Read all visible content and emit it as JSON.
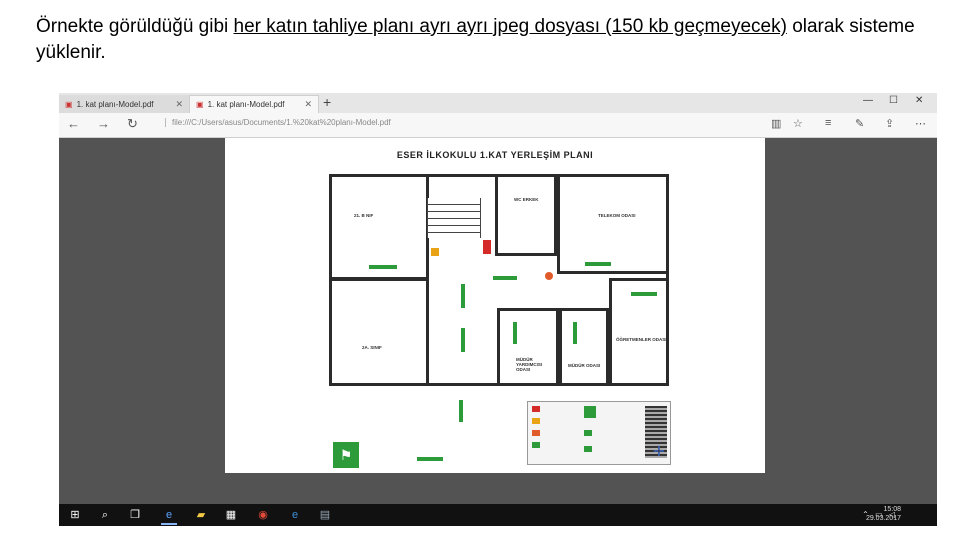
{
  "caption": {
    "part1": "Örnekte görüldüğü gibi ",
    "underlined": "her katın tahliye planı ayrı ayrı jpeg dosyası (150 kb geçmeyecek)",
    "part2": " olarak sisteme yüklenir."
  },
  "browser": {
    "tabs": [
      {
        "label": "1. kat planı-Model.pdf",
        "active": false
      },
      {
        "label": "1. kat planı-Model.pdf",
        "active": true
      }
    ],
    "new_tab": "+",
    "window_controls": {
      "minimize": "—",
      "maximize": "☐",
      "close": "✕"
    },
    "address": "file:///C:/Users/asus/Documents/1.%20kat%20planı-Model.pdf",
    "icons": [
      "back-icon",
      "forward-icon",
      "refresh-icon",
      "reading-view-icon",
      "favorite-icon",
      "hub-icon",
      "note-icon",
      "share-icon",
      "more-icon"
    ]
  },
  "plan": {
    "title": "ESER İLKOKULU 1.KAT YERLEŞİM PLANI",
    "rooms": {
      "r1": "21. B NIF",
      "r2": "WC ERKEK",
      "r3": "TELEKOM ODASI",
      "r4": "2A. SINIF",
      "r5": "MÜDÜR YARDIMCISI ODASI",
      "r6": "MÜDÜR ODASI",
      "r7": "ÖĞRETMENLER ODASI"
    }
  },
  "taskbar": {
    "clock_time": "15:08",
    "clock_date": "29.03.2017",
    "icons": [
      "windows-icon",
      "search-icon",
      "task-view-icon",
      "edge-icon",
      "explorer-icon",
      "store-icon",
      "chrome-icon",
      "ie-icon",
      "app-icon"
    ]
  },
  "colors": {
    "exit_green": "#2e9b3a",
    "viewer_bg": "#535353"
  }
}
